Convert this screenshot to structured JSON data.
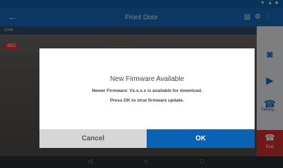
{
  "app_bar": {
    "title": "Front Door"
  },
  "feed": {
    "camera_label": "Live"
  },
  "rec_badge": "REC",
  "side_panel": {
    "talk_label": "Talking...",
    "end_label": "End"
  },
  "dialog": {
    "title": "New Firmware Available",
    "line1": "Newer Firmware: Vx.x.x.x is available for download.",
    "line2": "Press OK to strat firmware update.",
    "cancel_label": "Cancel",
    "ok_label": "OK"
  },
  "colors": {
    "primary": "#1565b4",
    "ok_button": "#0a62b5",
    "end_call": "#c9302c"
  },
  "icons": [
    "back-arrow-icon",
    "settings-icon",
    "camera-icon",
    "video-icon",
    "phone-icon",
    "end-call-icon",
    "nav-back-icon",
    "nav-home-icon",
    "nav-recents-icon"
  ]
}
